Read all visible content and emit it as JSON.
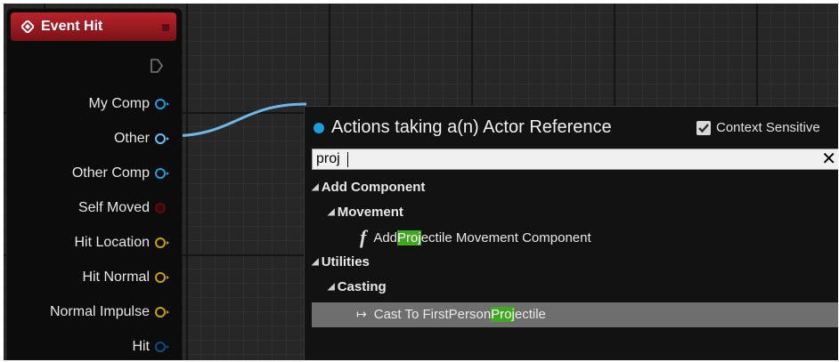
{
  "node": {
    "title": "Event Hit",
    "pins": [
      {
        "label": "My Comp",
        "color": "#1e9ddc"
      },
      {
        "label": "Other",
        "color": "#1e9ddc"
      },
      {
        "label": "Other Comp",
        "color": "#1e9ddc"
      },
      {
        "label": "Self Moved",
        "color": "#8a0e0e"
      },
      {
        "label": "Hit Location",
        "color": "#e6b800"
      },
      {
        "label": "Hit Normal",
        "color": "#e6b800"
      },
      {
        "label": "Normal Impulse",
        "color": "#e6b800"
      },
      {
        "label": "Hit",
        "color": "#0a4e8a"
      }
    ]
  },
  "menu": {
    "title": "Actions taking a(n) Actor Reference",
    "context_sensitive_label": "Context Sensitive",
    "context_sensitive_checked": true,
    "search_value": "proj",
    "categories": {
      "add_component": "Add Component",
      "movement": "Movement",
      "utilities": "Utilities",
      "casting": "Casting"
    },
    "items": {
      "add_projectile": {
        "pre": "Add ",
        "match": "Proj",
        "post": "ectile Movement Component"
      },
      "cast_projectile": {
        "pre": "Cast To FirstPerson",
        "match": "Proj",
        "post": "ectile"
      }
    }
  },
  "colors": {
    "event_header": "#b8242a",
    "object_pin": "#1e9ddc",
    "vector_pin": "#e6b800",
    "highlight": "#3fa81e",
    "selected_row": "#6e6e6e"
  }
}
